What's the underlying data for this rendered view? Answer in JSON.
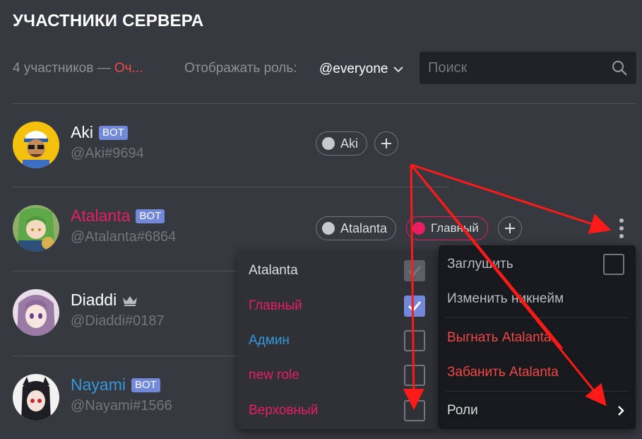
{
  "page_title": "УЧАСТНИКИ СЕРВЕРА",
  "toolbar": {
    "count_text": "4 участников — ",
    "count_red": "Оч...",
    "role_label": "Отображать роль:",
    "role_value": "@everyone",
    "search_placeholder": "Поиск"
  },
  "members": [
    {
      "name": "Aki",
      "tag": "@Aki#9694",
      "badge": "BOT",
      "name_color": "#ffffff",
      "roles": [
        {
          "label": "Aki",
          "color": "#dcddde"
        }
      ]
    },
    {
      "name": "Atalanta",
      "tag": "@Atalanta#6864",
      "badge": "BOT",
      "name_color": "#e91e63",
      "roles": [
        {
          "label": "Atalanta",
          "color": "#dcddde"
        },
        {
          "label": "Главный",
          "color": "#e91e63"
        }
      ]
    },
    {
      "name": "Diaddi",
      "tag": "@Diaddi#0187",
      "badge": "",
      "name_color": "#ffffff",
      "crown": "owner-crown-icon"
    },
    {
      "name": "Nayami",
      "tag": "@Nayami#1566",
      "badge": "BOT",
      "name_color": "#3498db"
    }
  ],
  "role_menu": [
    {
      "label": "Atalanta",
      "color": "#dcddde",
      "checked": true,
      "disabled": true
    },
    {
      "label": "Главный",
      "color": "#e91e63",
      "checked": true,
      "disabled": false
    },
    {
      "label": "Админ",
      "color": "#3498db",
      "checked": false,
      "disabled": false
    },
    {
      "label": "new role",
      "color": "#e91e63",
      "checked": false,
      "disabled": false
    },
    {
      "label": "Верховный",
      "color": "#e91e63",
      "checked": false,
      "disabled": false
    }
  ],
  "context_menu": {
    "mute": "Заглушить",
    "nickname": "Изменить никнейм",
    "kick": "Выгнать Atalanta",
    "ban": "Забанить Atalanta",
    "roles": "Роли"
  },
  "colors": {
    "background": "#36393f",
    "danger": "#f04747",
    "bot_badge": "#7289da",
    "annotation_arrow": "#ff0000"
  }
}
